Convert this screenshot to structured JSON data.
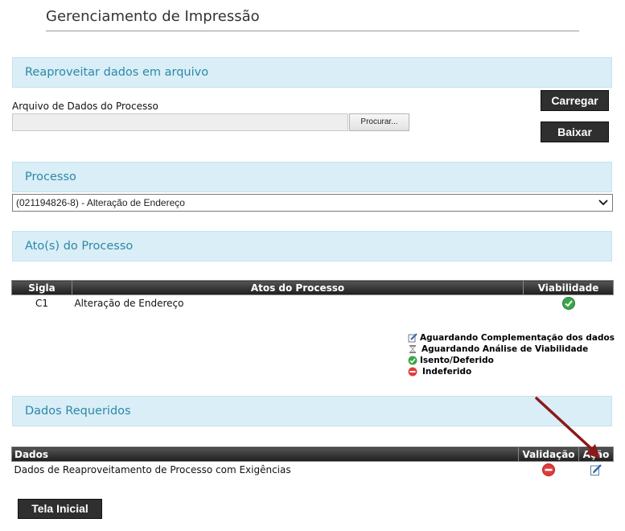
{
  "page": {
    "title": "Gerenciamento de Impressão"
  },
  "reuse": {
    "section_title": "Reaproveitar dados em arquivo",
    "file_label": "Arquivo de Dados do Processo",
    "browse_label": "Procurar...",
    "load_label": "Carregar",
    "download_label": "Baixar"
  },
  "process": {
    "section_title": "Processo",
    "selected": "(021194826-8) - Alteração de Endereço"
  },
  "acts": {
    "section_title": "Ato(s) do Processo",
    "headers": {
      "sigla": "Sigla",
      "atos": "Atos do Processo",
      "viabilidade": "Viabilidade"
    },
    "rows": [
      {
        "sigla": "C1",
        "ato": "Alteração de Endereço",
        "status_icon": "check-circle-icon"
      }
    ]
  },
  "legend": [
    {
      "icon": "edit-icon",
      "label": "Aguardando Complementação dos dados"
    },
    {
      "icon": "hourglass-icon",
      "label": "Aguardando Análise de Viabilidade"
    },
    {
      "icon": "check-circle-icon",
      "label": "Isento/Deferido"
    },
    {
      "icon": "no-entry-icon",
      "label": "Indeferido"
    }
  ],
  "required": {
    "section_title": "Dados Requeridos",
    "headers": {
      "dados": "Dados",
      "validacao": "Validação",
      "acao": "Ação"
    },
    "rows": [
      {
        "dados": "Dados de Reaproveitamento de Processo com Exigências",
        "validation_icon": "no-entry-icon",
        "action_icon": "edit-icon"
      }
    ]
  },
  "home_button": "Tela Inicial",
  "colors": {
    "section_bg": "#d9eef6",
    "section_text": "#2e87a8",
    "button_bg": "#2f2f2f",
    "arrow": "#8b1a1a"
  }
}
